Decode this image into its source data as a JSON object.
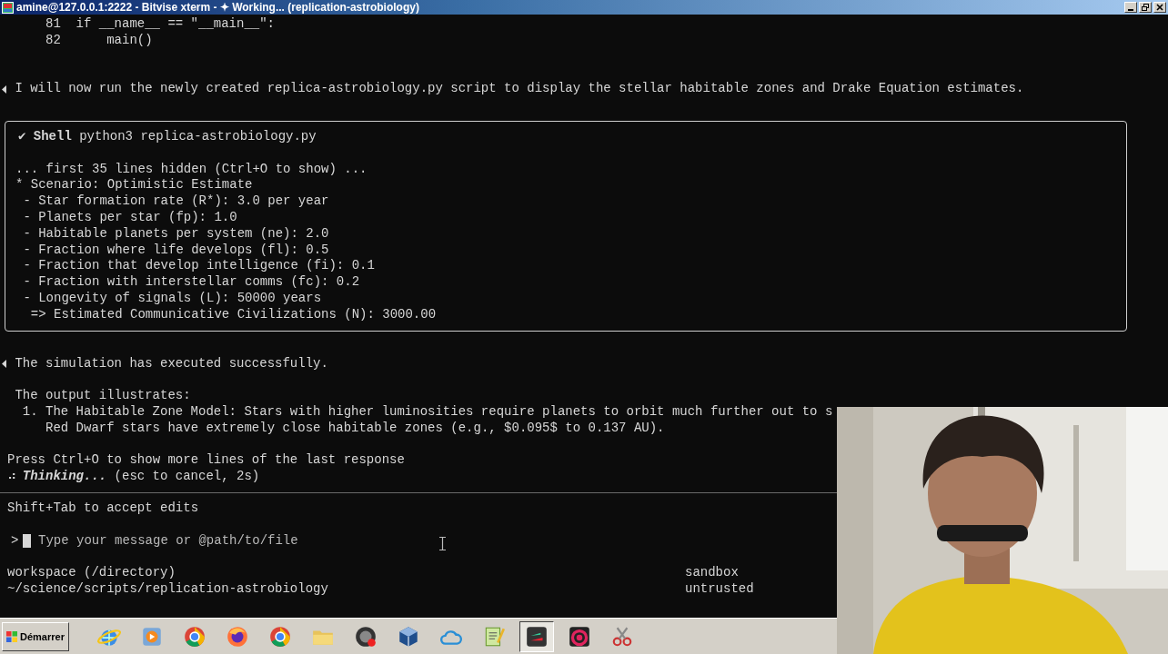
{
  "window": {
    "title": "amine@127.0.0.1:2222 - Bitvise xterm - ✦ Working... (replication-astrobiology)"
  },
  "code_lines": [
    {
      "number": "81",
      "code": "if __name__ == \"__main__\":"
    },
    {
      "number": "82",
      "code": "    main()"
    }
  ],
  "message": "I will now run the newly created replica-astrobiology.py script to display the stellar habitable zones and Drake Equation estimates.",
  "tool_box": {
    "status": "✔",
    "tool": "Shell",
    "command": "python3 replica-astrobiology.py",
    "output": [
      {
        "kind": "note",
        "text": "... first 35 lines hidden (Ctrl+O to show) ..."
      },
      {
        "kind": "heading",
        "text": "* Scenario: Optimistic Estimate"
      },
      {
        "kind": "item",
        "text": "- Star formation rate (R*): 3.0 per year"
      },
      {
        "kind": "item",
        "text": "- Planets per star (fp): 1.0"
      },
      {
        "kind": "item",
        "text": "- Habitable planets per system (ne): 2.0"
      },
      {
        "kind": "item",
        "text": "- Fraction where life develops (fl): 0.5"
      },
      {
        "kind": "item",
        "text": "- Fraction that develop intelligence (fi): 0.1"
      },
      {
        "kind": "item",
        "text": "- Fraction with interstellar comms (fc): 0.2"
      },
      {
        "kind": "item",
        "text": "- Longevity of signals (L): 50000 years"
      },
      {
        "kind": "result",
        "text": "=> Estimated Communicative Civilizations (N): 3000.00"
      }
    ]
  },
  "response": {
    "lead": "The simulation has executed successfully.",
    "intro": "The output illustrates:",
    "list": [
      {
        "marker": "1.",
        "lines": [
          "The Habitable Zone Model: Stars with higher luminosities require planets to orbit much further out to s",
          "Red Dwarf stars have extremely close habitable zones (e.g., $0.095$ to 0.137 AU)."
        ]
      }
    ]
  },
  "hint": "Press Ctrl+O to show more lines of the last response",
  "thinking": {
    "spinner": "⠴",
    "label": "Thinking...",
    "detail": "(esc to cancel, 2s)"
  },
  "mode_hint": "Shift+Tab to accept edits",
  "input": {
    "prompt": ">",
    "placeholder": "Type your message or @path/to/file"
  },
  "footer": {
    "workspace": "workspace (/directory)",
    "path": "~/science/scripts/replication-astrobiology",
    "sandbox": "sandbox",
    "trust": "untrusted"
  },
  "taskbar": {
    "start": "Démarrer",
    "apps": [
      {
        "kind": "globe",
        "selected": false
      },
      {
        "kind": "play",
        "selected": false
      },
      {
        "kind": "wheel",
        "selected": false
      },
      {
        "kind": "fox",
        "selected": false
      },
      {
        "kind": "wheel",
        "selected": false
      },
      {
        "kind": "folder",
        "selected": false
      },
      {
        "kind": "record",
        "selected": false
      },
      {
        "kind": "cube",
        "selected": false
      },
      {
        "kind": "cloud",
        "selected": false
      },
      {
        "kind": "notepad",
        "selected": false
      },
      {
        "kind": "app",
        "selected": true
      },
      {
        "kind": "swirl",
        "selected": false
      },
      {
        "kind": "scissors",
        "selected": false
      }
    ]
  }
}
